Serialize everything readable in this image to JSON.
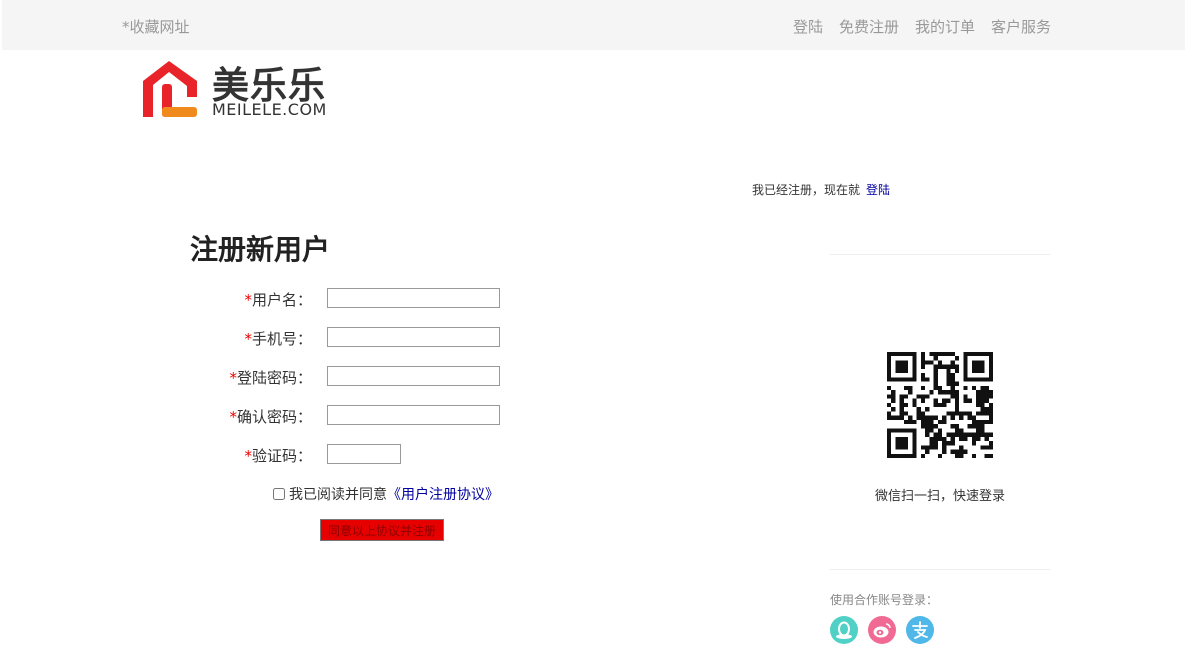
{
  "header": {
    "bookmark": "*收藏网址",
    "nav": [
      {
        "label": "登陆"
      },
      {
        "label": "免费注册"
      },
      {
        "label": "我的订单"
      },
      {
        "label": "客户服务"
      }
    ]
  },
  "logo": {
    "name_cn": "美乐乐",
    "name_en": "MEILELE.COM",
    "color_red": "#e8242a",
    "color_orange": "#f08a1c"
  },
  "login_hint": {
    "text": "我已经注册，现在就",
    "link": "登陆"
  },
  "form": {
    "title": "注册新用户",
    "required_mark": "*",
    "fields": [
      {
        "label": "用户名：",
        "value": ""
      },
      {
        "label": "手机号：",
        "value": ""
      },
      {
        "label": "登陆密码：",
        "value": ""
      },
      {
        "label": "确认密码：",
        "value": ""
      },
      {
        "label": "验证码：",
        "value": ""
      }
    ],
    "agree_text": "我已阅读并同意",
    "agree_link": "《用户注册协议》",
    "submit_label": "同意以上协议并注册"
  },
  "sidebar": {
    "qr_caption": "微信扫一扫，快速登录",
    "partner_label": "使用合作账号登录：",
    "partners": [
      {
        "icon": "qq-icon",
        "color": "#4fd1c5"
      },
      {
        "icon": "weibo-icon",
        "color": "#f06a93"
      },
      {
        "icon": "alipay-icon",
        "color": "#4fb8e8"
      }
    ]
  }
}
